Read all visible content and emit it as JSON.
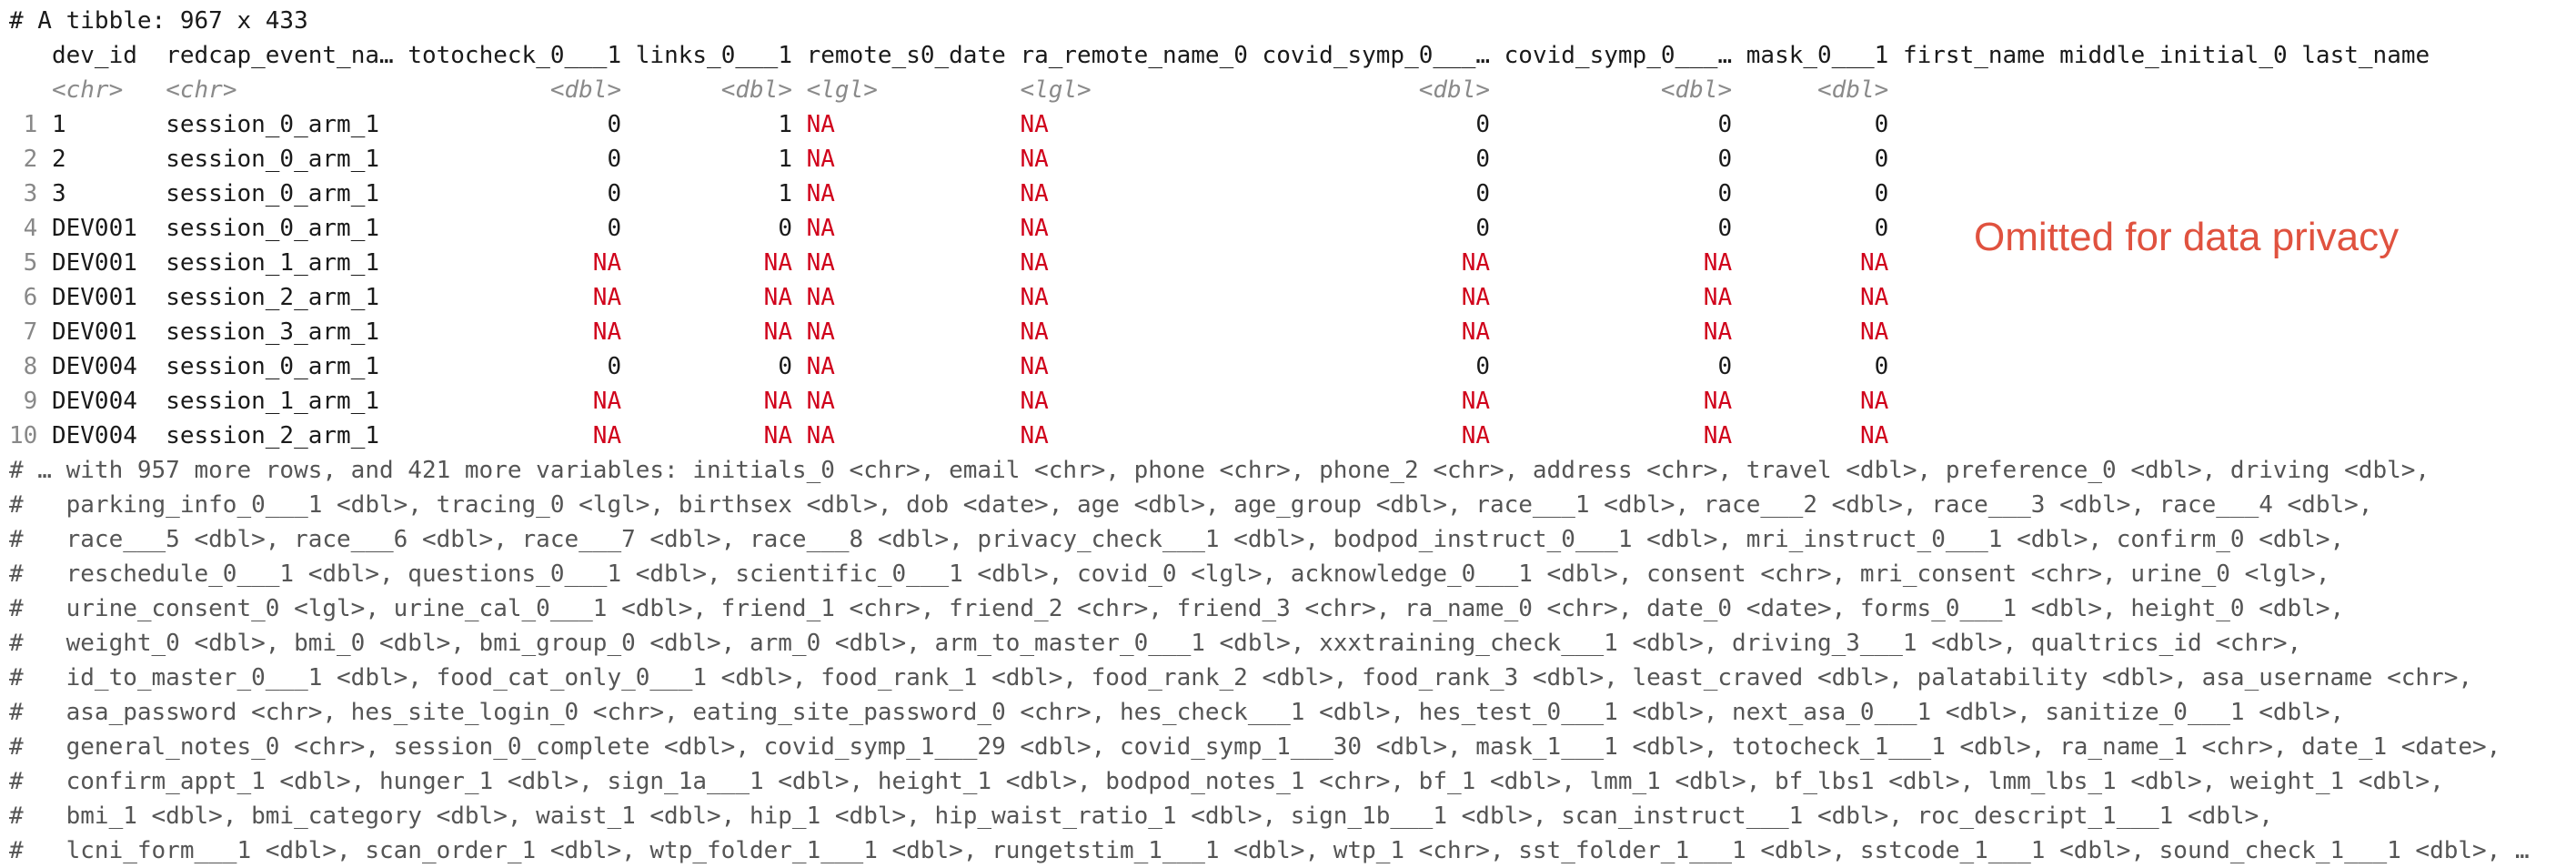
{
  "tibble_header": "# A tibble: 967 x 433",
  "columns": [
    {
      "name": "dev_id",
      "type": "<chr>",
      "width": 7,
      "align": "left"
    },
    {
      "name": "redcap_event_na…",
      "type": "<chr>",
      "width": 16,
      "align": "left"
    },
    {
      "name": "totocheck_0___1",
      "type": "<dbl>",
      "width": 15,
      "align": "right"
    },
    {
      "name": "links_0___1",
      "type": "<dbl>",
      "width": 11,
      "align": "right"
    },
    {
      "name": "remote_s0_date",
      "type": "<lgl>",
      "width": 14,
      "align": "left"
    },
    {
      "name": "ra_remote_name_0",
      "type": "<lgl>",
      "width": 16,
      "align": "left"
    },
    {
      "name": "covid_symp_0___…",
      "type": "<dbl>",
      "width": 16,
      "align": "right"
    },
    {
      "name": "covid_symp_0___…",
      "type": "<dbl>",
      "width": 16,
      "align": "right"
    },
    {
      "name": "mask_0___1",
      "type": "<dbl>",
      "width": 10,
      "align": "right"
    },
    {
      "name": "first_name",
      "type": "",
      "width": 10,
      "align": "left"
    },
    {
      "name": "middle_initial_0",
      "type": "",
      "width": 16,
      "align": "left"
    },
    {
      "name": "last_name",
      "type": "",
      "width": 9,
      "align": "left"
    }
  ],
  "rows": [
    {
      "n": "1",
      "cells": [
        "1",
        "session_0_arm_1",
        "0",
        "1",
        "NA",
        "NA",
        "0",
        "0",
        "0"
      ]
    },
    {
      "n": "2",
      "cells": [
        "2",
        "session_0_arm_1",
        "0",
        "1",
        "NA",
        "NA",
        "0",
        "0",
        "0"
      ]
    },
    {
      "n": "3",
      "cells": [
        "3",
        "session_0_arm_1",
        "0",
        "1",
        "NA",
        "NA",
        "0",
        "0",
        "0"
      ]
    },
    {
      "n": "4",
      "cells": [
        "DEV001",
        "session_0_arm_1",
        "0",
        "0",
        "NA",
        "NA",
        "0",
        "0",
        "0"
      ]
    },
    {
      "n": "5",
      "cells": [
        "DEV001",
        "session_1_arm_1",
        "NA",
        "NA",
        "NA",
        "NA",
        "NA",
        "NA",
        "NA"
      ]
    },
    {
      "n": "6",
      "cells": [
        "DEV001",
        "session_2_arm_1",
        "NA",
        "NA",
        "NA",
        "NA",
        "NA",
        "NA",
        "NA"
      ]
    },
    {
      "n": "7",
      "cells": [
        "DEV001",
        "session_3_arm_1",
        "NA",
        "NA",
        "NA",
        "NA",
        "NA",
        "NA",
        "NA"
      ]
    },
    {
      "n": "8",
      "cells": [
        "DEV004",
        "session_0_arm_1",
        "0",
        "0",
        "NA",
        "NA",
        "0",
        "0",
        "0"
      ]
    },
    {
      "n": "9",
      "cells": [
        "DEV004",
        "session_1_arm_1",
        "NA",
        "NA",
        "NA",
        "NA",
        "NA",
        "NA",
        "NA"
      ]
    },
    {
      "n": "10",
      "cells": [
        "DEV004",
        "session_2_arm_1",
        "NA",
        "NA",
        "NA",
        "NA",
        "NA",
        "NA",
        "NA"
      ]
    }
  ],
  "overlay_note": "Omitted for data privacy",
  "footer_lines": [
    "# … with 957 more rows, and 421 more variables: initials_0 <chr>, email <chr>, phone <chr>, phone_2 <chr>, address <chr>, travel <dbl>, preference_0 <dbl>, driving <dbl>,",
    "#   parking_info_0___1 <dbl>, tracing_0 <lgl>, birthsex <dbl>, dob <date>, age <dbl>, age_group <dbl>, race___1 <dbl>, race___2 <dbl>, race___3 <dbl>, race___4 <dbl>,",
    "#   race___5 <dbl>, race___6 <dbl>, race___7 <dbl>, race___8 <dbl>, privacy_check___1 <dbl>, bodpod_instruct_0___1 <dbl>, mri_instruct_0___1 <dbl>, confirm_0 <dbl>,",
    "#   reschedule_0___1 <dbl>, questions_0___1 <dbl>, scientific_0___1 <dbl>, covid_0 <lgl>, acknowledge_0___1 <dbl>, consent <chr>, mri_consent <chr>, urine_0 <lgl>,",
    "#   urine_consent_0 <lgl>, urine_cal_0___1 <dbl>, friend_1 <chr>, friend_2 <chr>, friend_3 <chr>, ra_name_0 <chr>, date_0 <date>, forms_0___1 <dbl>, height_0 <dbl>,",
    "#   weight_0 <dbl>, bmi_0 <dbl>, bmi_group_0 <dbl>, arm_0 <dbl>, arm_to_master_0___1 <dbl>, xxxtraining_check___1 <dbl>, driving_3___1 <dbl>, qualtrics_id <chr>,",
    "#   id_to_master_0___1 <dbl>, food_cat_only_0___1 <dbl>, food_rank_1 <dbl>, food_rank_2 <dbl>, food_rank_3 <dbl>, least_craved <dbl>, palatability <dbl>, asa_username <chr>,",
    "#   asa_password <chr>, hes_site_login_0 <chr>, eating_site_password_0 <chr>, hes_check___1 <dbl>, hes_test_0___1 <dbl>, next_asa_0___1 <dbl>, sanitize_0___1 <dbl>,",
    "#   general_notes_0 <chr>, session_0_complete <dbl>, covid_symp_1___29 <dbl>, covid_symp_1___30 <dbl>, mask_1___1 <dbl>, totocheck_1___1 <dbl>, ra_name_1 <chr>, date_1 <date>,",
    "#   confirm_appt_1 <dbl>, hunger_1 <dbl>, sign_1a___1 <dbl>, height_1 <dbl>, bodpod_notes_1 <chr>, bf_1 <dbl>, lmm_1 <dbl>, bf_lbs1 <dbl>, lmm_lbs_1 <dbl>, weight_1 <dbl>,",
    "#   bmi_1 <dbl>, bmi_category <dbl>, waist_1 <dbl>, hip_1 <dbl>, hip_waist_ratio_1 <dbl>, sign_1b___1 <dbl>, scan_instruct___1 <dbl>, roc_descript_1___1 <dbl>,",
    "#   lcni_form___1 <dbl>, scan_order_1 <dbl>, wtp_folder_1___1 <dbl>, rungetstim_1___1 <dbl>, wtp_1 <chr>, sst_folder_1___1 <dbl>, sstcode_1___1 <dbl>, sound_check_1___1 <dbl>, …"
  ]
}
